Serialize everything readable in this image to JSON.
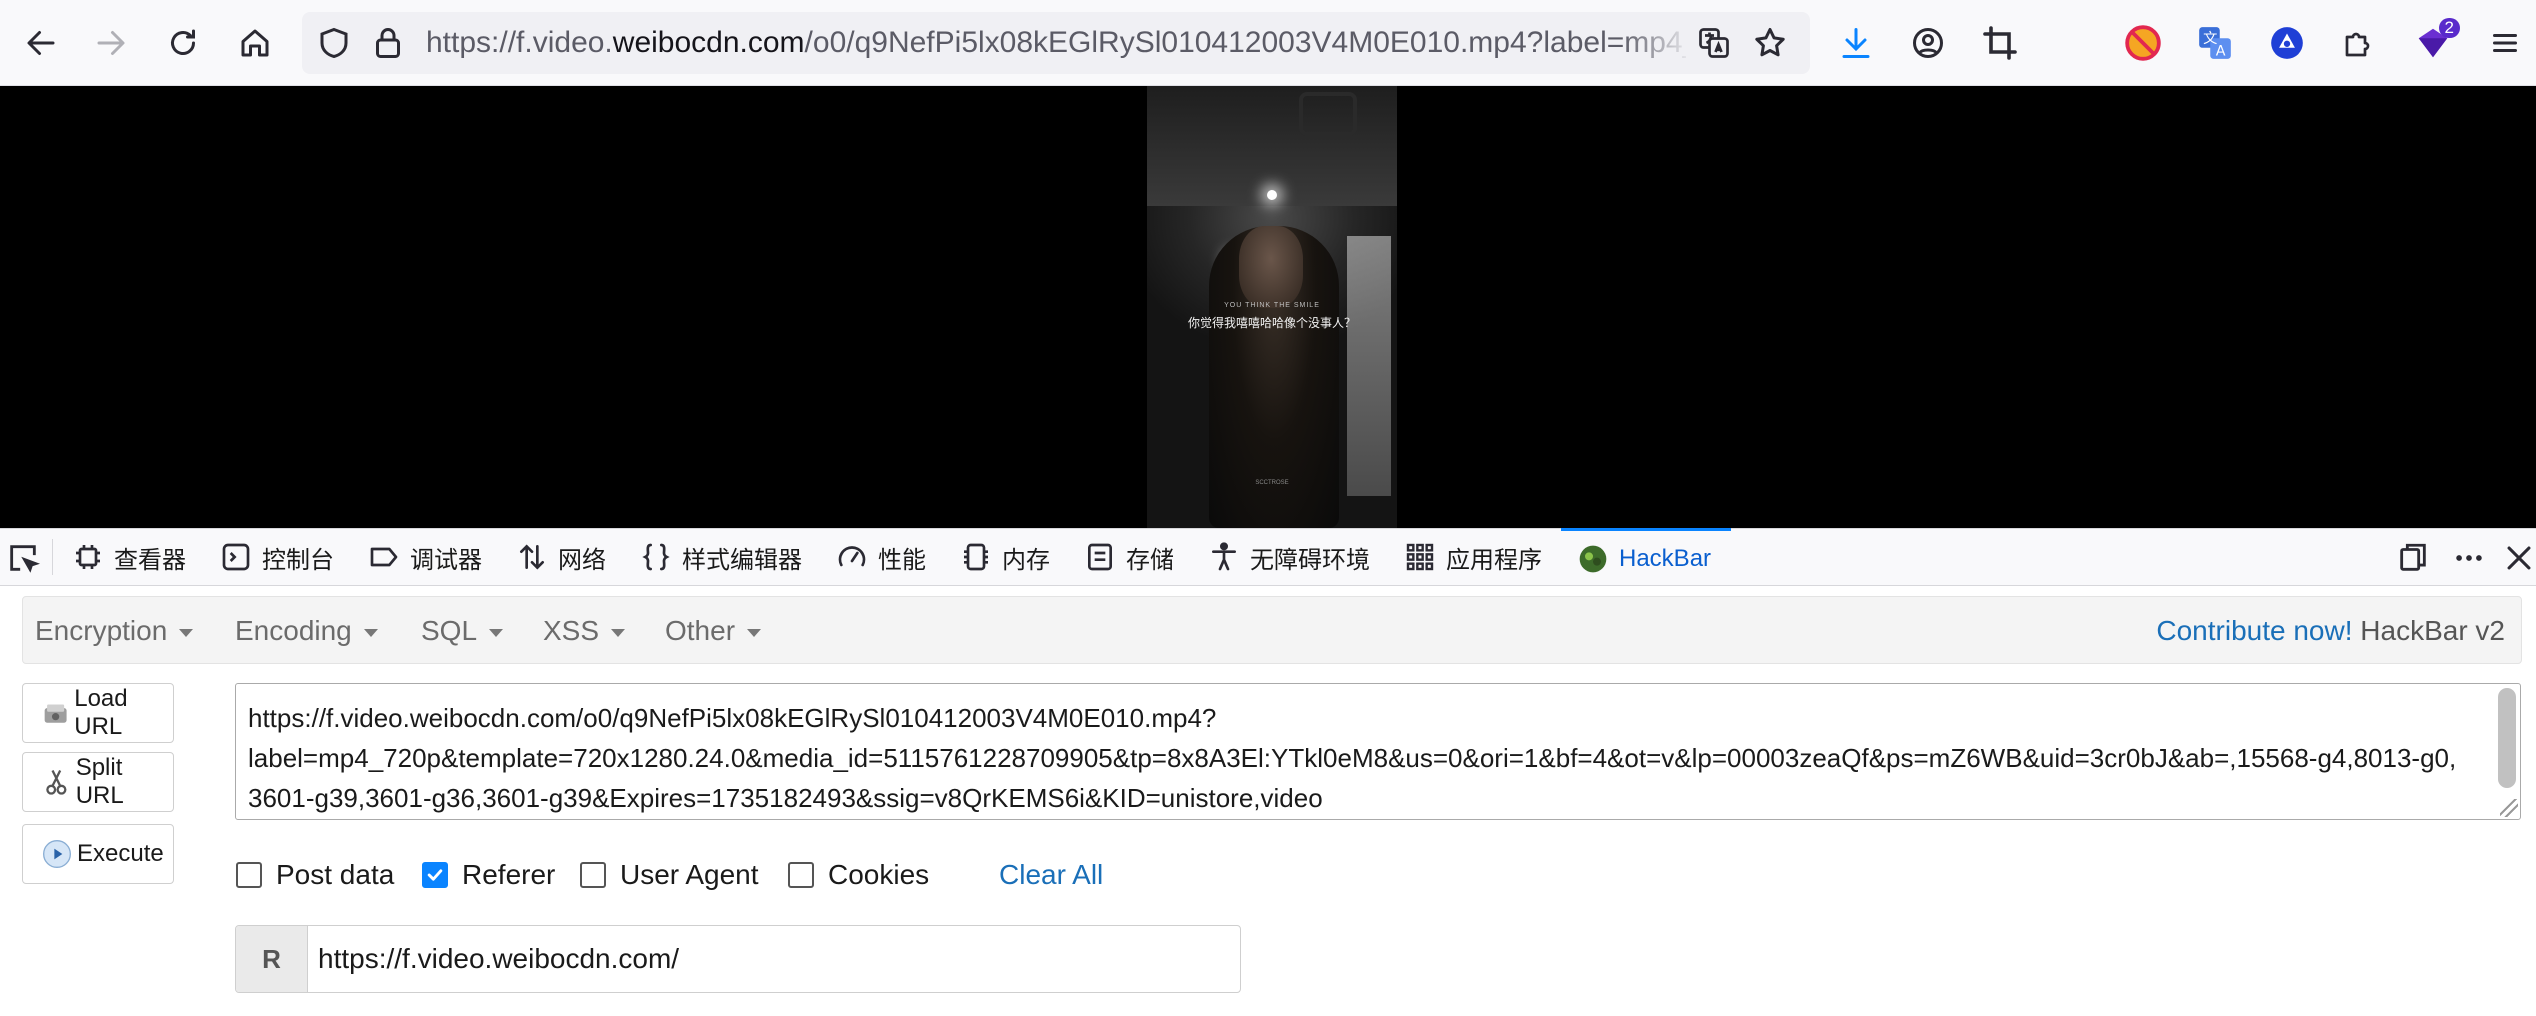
{
  "browser": {
    "url_full": "https://f.video.weibocdn.com/o0/q9NefPi5lx08kEGlRySl010412003V4M0E010.mp4?label=mp4_720p&template=720x1280.24.0&media_id=5115761228709905&tp=8x8A3El:YTkl0eM8&us=0&ori=1&bf=4&ot=v&lp=00003zeaQf&ps=mZ6WB&uid=3cr0bJ&ab=,15568-g4,8013-g0,3601-g39,3601-g36,3601-g39&Expires=1735182493&ssig=v8QrKEMS6i&KID=unistore,video",
    "url_prefix": "https://f.video.",
    "url_domain": "weibocdn.com",
    "url_path": "/o0/q9NefPi5lx08kEGlRySl010412003V4M0E010.mp4?label=mp4_720p&template=720",
    "extension_badge": "2"
  },
  "video": {
    "subtitle_small": "YOU THINK THE SMILE",
    "subtitle_main": "你觉得我嘻嘻哈哈像个没事人？",
    "watermark": "SCCTROSE"
  },
  "devtools": {
    "tabs": [
      {
        "label": "查看器"
      },
      {
        "label": "控制台"
      },
      {
        "label": "调试器"
      },
      {
        "label": "网络"
      },
      {
        "label": "样式编辑器"
      },
      {
        "label": "性能"
      },
      {
        "label": "内存"
      },
      {
        "label": "存储"
      },
      {
        "label": "无障碍环境"
      },
      {
        "label": "应用程序"
      },
      {
        "label": "HackBar"
      }
    ]
  },
  "hackbar": {
    "menus": [
      "Encryption",
      "Encoding",
      "SQL",
      "XSS",
      "Other"
    ],
    "contribute_link": "Contribute now!",
    "version": "HackBar v2",
    "buttons": {
      "load": "Load URL",
      "split": "Split URL",
      "execute": "Execute"
    },
    "url_value": "https://f.video.weibocdn.com/o0/q9NefPi5lx08kEGlRySl010412003V4M0E010.mp4?\nlabel=mp4_720p&template=720x1280.24.0&media_id=5115761228709905&tp=8x8A3El:YTkl0eM8&us=0&ori=1&bf=4&ot=v&lp=00003zeaQf&ps=mZ6WB&uid=3cr0bJ&ab=,15568-g4,8013-g0,3601-g39,3601-g36,3601-g39&Expires=1735182493&ssig=v8QrKEMS6i&KID=unistore,video",
    "options": [
      {
        "label": "Post data",
        "checked": false
      },
      {
        "label": "Referer",
        "checked": true
      },
      {
        "label": "User Agent",
        "checked": false
      },
      {
        "label": "Cookies",
        "checked": false
      }
    ],
    "clear_all": "Clear All",
    "referer_label": "R",
    "referer_value": "https://f.video.weibocdn.com/"
  },
  "colors": {
    "accent": "#0a84ff",
    "link": "#1a6fb8",
    "active_tab": "#0a5fcf"
  }
}
